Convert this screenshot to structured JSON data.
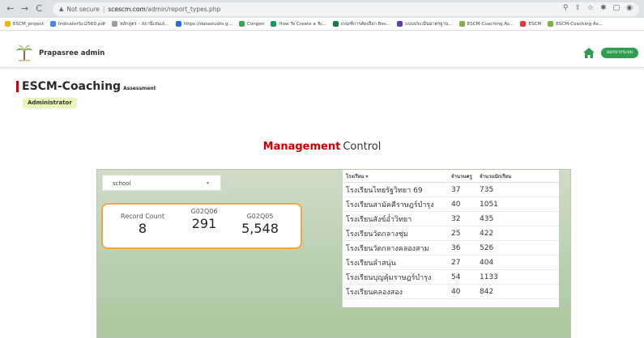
{
  "browser": {
    "back_icon": "←",
    "forward_icon": "→",
    "reload_icon": "C",
    "security_label": "Not secure",
    "separator": "|",
    "url_host": "scescm.com",
    "url_path": "/admin/report_types.php",
    "bookmarks": [
      {
        "label": "ESCM_project",
        "color": "#f4b400"
      },
      {
        "label": "IndicatorSci2560.pdf",
        "color": "#4285f4"
      },
      {
        "label": "หลักสูตร – สถานีเล่นเล่...",
        "color": "#9e9e9e"
      },
      {
        "label": "https://datastudio.g...",
        "color": "#1a73e8"
      },
      {
        "label": "Congen",
        "color": "#34a853"
      },
      {
        "label": "How To Create a To...",
        "color": "#0f9d58"
      },
      {
        "label": "เกณฑ์การคัดเลือก Bes...",
        "color": "#0b8043"
      },
      {
        "label": "แบบประเมินมาตรฐาน...",
        "color": "#673ab7"
      },
      {
        "label": "ESCM-Coaching As...",
        "color": "#7cb342"
      },
      {
        "label": "ESCM",
        "color": "#e53935"
      },
      {
        "label": "ESCM-Coaching As...",
        "color": "#7cb342"
      }
    ]
  },
  "header": {
    "brand": "Prapasree admin",
    "logout_label": "ออกจากระบบ"
  },
  "page": {
    "title_main": "ESCM-Coaching",
    "title_sub": "Assessment",
    "role": "Administrator",
    "section_red": "Management",
    "section_dark": "Control"
  },
  "dashboard": {
    "filter_label": "school",
    "metrics": [
      {
        "label": "Record Count",
        "value": "8"
      },
      {
        "label": "G02Q06",
        "value": "291"
      },
      {
        "label": "G02Q05",
        "value": "5,548"
      }
    ],
    "table": {
      "headers": [
        "โรงเรียน ▾",
        "จำนวนครู",
        "จำนวนนักเรียน"
      ],
      "rows": [
        [
          "โรงเรียนไทยรัฐวิทยา 69",
          "37",
          "735"
        ],
        [
          "โรงเรียนสามัคคีราษฎร์บำรุง",
          "40",
          "1051"
        ],
        [
          "โรงเรียนสังข์อ่ำวิทยา",
          "32",
          "435"
        ],
        [
          "โรงเรียนวัดกลางชุ่ม",
          "25",
          "422"
        ],
        [
          "โรงเรียนวัดกลางคลองสาม",
          "36",
          "526"
        ],
        [
          "โรงเรียนลำสนุ่น",
          "27",
          "404"
        ],
        [
          "โรงเรียนบุญคุ้มราษฎร์บำรุง",
          "54",
          "1133"
        ],
        [
          "โรงเรียนคลองสอง",
          "40",
          "842"
        ]
      ]
    }
  },
  "colors": {
    "accent_red": "#d00000",
    "button_green": "#2e9d4f",
    "card_border": "#f4a63b"
  }
}
